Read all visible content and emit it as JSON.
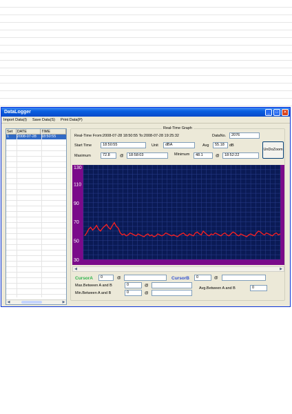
{
  "window": {
    "title": "DataLogger",
    "controls": [
      "_",
      "□",
      "✕"
    ]
  },
  "menu": [
    "Import Data(I)",
    "Save Data(S)",
    "Print Data(P)"
  ],
  "list": {
    "headers": [
      "Set",
      "DATE",
      "TIME"
    ],
    "rows": [
      [
        "1",
        "2008-07-28",
        "18:50:55"
      ]
    ]
  },
  "graph": {
    "title": "Real-Time Graph",
    "range_text": "Real-Time From:2008-07-28 18:50:55 To:2008-07-28 19:25:32",
    "datano_label": "DataNo.",
    "datano_value": "2076",
    "start_time_label": "Start Time",
    "start_time_value": "18:50:55",
    "unit_label": "Unit",
    "unit_value": "dBA",
    "avg_label": "Avg",
    "avg_value": "55.18",
    "avg_unit": "dB",
    "maximum_label": "Maximum",
    "maximum_value": "72.8",
    "max_at": "@",
    "maximum_time": "18:58:03",
    "minimum_label": "Minimum",
    "minimum_value": "48.1",
    "min_at": "@",
    "minimum_time": "18:52:22",
    "undo_label": "UnDoZoom",
    "cursor_a_label": "CursorA",
    "cursor_a_value": "0",
    "cursor_a_at": "@",
    "cursor_b_label": "CursorB",
    "cursor_b_value": "0",
    "cursor_b_at": "@",
    "max_between_label": "Max.Between A and B",
    "max_between_value": "0",
    "max_between_at": "@",
    "min_between_label": "Min.Between A and B",
    "min_between_value": "0",
    "min_between_at": "@",
    "avg_between_label": "Avg.Between A and B",
    "avg_between_value": "0"
  },
  "colors": {
    "plot_bg": "#0a1a55",
    "grid": "#2a3f8e",
    "axis_band": "#7a0a8a",
    "trace": "#ff2020",
    "cursor_a": "#2bb34a",
    "cursor_b": "#2f4fd0"
  },
  "chart_data": {
    "type": "line",
    "title": "",
    "xlabel": "",
    "ylabel": "",
    "ylim": [
      30,
      130
    ],
    "yticks": [
      "130",
      "110",
      "90",
      "70",
      "50",
      "30"
    ],
    "series": [
      {
        "values": [
          55,
          58,
          62,
          64,
          61,
          63,
          66,
          62,
          60,
          63,
          65,
          67,
          64,
          62,
          66,
          69,
          65,
          63,
          58,
          56,
          57,
          55,
          56,
          58,
          57,
          56,
          55,
          57,
          56,
          55,
          54,
          56,
          57,
          55,
          56,
          54,
          55,
          57,
          56,
          55,
          56,
          58,
          57,
          56,
          55,
          56,
          55,
          54,
          56,
          57,
          58,
          56,
          55,
          57,
          56,
          55,
          58,
          59,
          57,
          56,
          60,
          58,
          56,
          55,
          57,
          56,
          58,
          57,
          56,
          55,
          57,
          58,
          56,
          55,
          57,
          59,
          58,
          56,
          55,
          57,
          56,
          55,
          54,
          56,
          57,
          56,
          55,
          58,
          60,
          59,
          57,
          56,
          58,
          57,
          56,
          55,
          57,
          58,
          56,
          57
        ]
      }
    ]
  }
}
